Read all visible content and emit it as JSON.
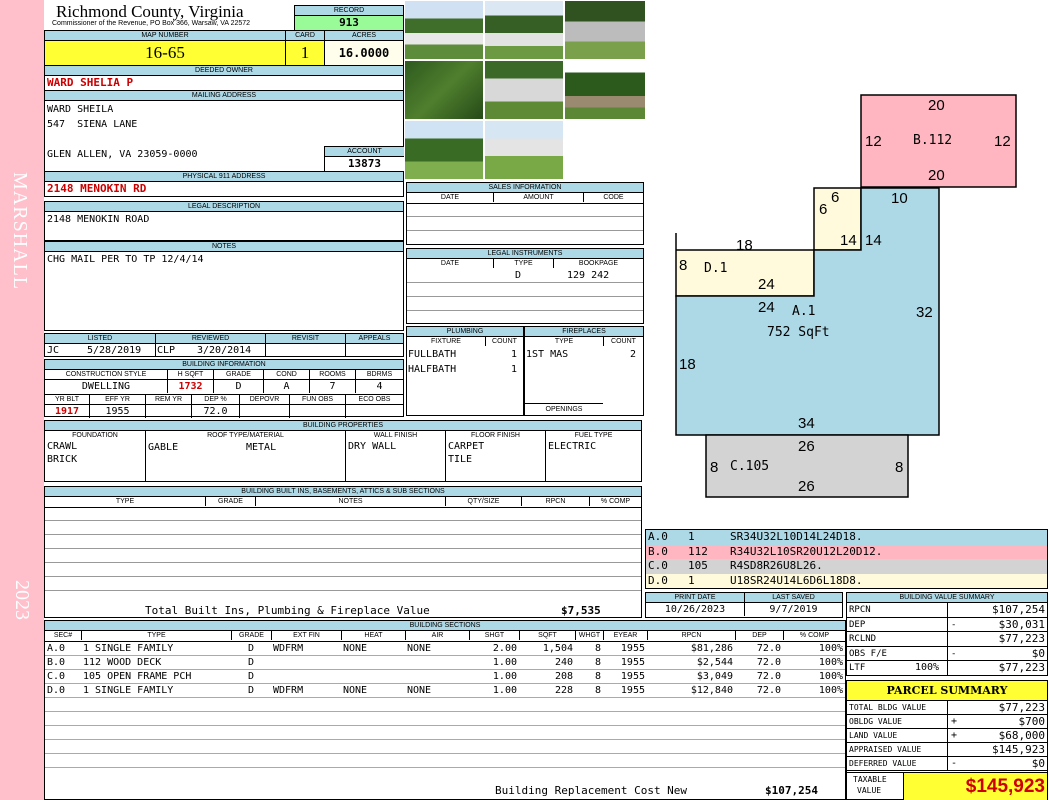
{
  "side": {
    "district": "MARSHALL",
    "year": "2023"
  },
  "county": {
    "name": "Richmond County, Virginia",
    "address": "Commissioner of the Revenue, PO Box 366, Warsaw, VA 22572"
  },
  "record": {
    "label": "RECORD",
    "value": "913"
  },
  "map": {
    "label": "MAP NUMBER",
    "value": "16-65",
    "card_label": "CARD",
    "card": "1",
    "acres_label": "ACRES",
    "acres": "16.0000"
  },
  "owner": {
    "label": "DEEDED OWNER",
    "value": "WARD SHELIA P"
  },
  "mailing": {
    "label": "MAILING ADDRESS",
    "line1": "WARD SHEILA",
    "line2": "547  SIENA LANE",
    "line3": "GLEN ALLEN, VA 23059-0000"
  },
  "account": {
    "label": "ACCOUNT",
    "value": "13873"
  },
  "physical": {
    "label": "PHYSICAL 911 ADDRESS",
    "value": "2148 MENOKIN RD"
  },
  "legal": {
    "label": "LEGAL DESCRIPTION",
    "value": "2148 MENOKIN ROAD"
  },
  "notes": {
    "label": "NOTES",
    "value": "CHG MAIL PER TO TP 12/4/14"
  },
  "review": {
    "listed_label": "LISTED",
    "reviewed_label": "REVIEWED",
    "revisit_label": "REVISIT",
    "appeals_label": "APPEALS",
    "listed_by": "JC",
    "listed_date": "5/28/2019",
    "reviewed_by": "CLP",
    "reviewed_date": "3/20/2014"
  },
  "building_info": {
    "label": "BUILDING INFORMATION",
    "h": [
      "CONSTRUCTION STYLE",
      "H SQFT",
      "GRADE",
      "COND",
      "ROOMS",
      "BDRMS"
    ],
    "v": [
      "DWELLING",
      "1732",
      "D",
      "A",
      "7",
      "4"
    ],
    "h2": [
      "YR BLT",
      "EFF YR",
      "REM YR",
      "DEP %",
      "DEPOVR",
      "FUN OBS",
      "ECO OBS"
    ],
    "v2": [
      "1917",
      "1955",
      "",
      "72.0",
      "",
      "",
      ""
    ]
  },
  "sales": {
    "label": "SALES INFORMATION",
    "h": [
      "DATE",
      "AMOUNT",
      "CODE"
    ]
  },
  "legal_inst": {
    "label": "LEGAL INSTRUMENTS",
    "h": [
      "DATE",
      "TYPE",
      "BOOKPAGE"
    ],
    "type": "D",
    "bookpage": "129 242"
  },
  "plumbing": {
    "label": "PLUMBING",
    "h": [
      "FIXTURE",
      "COUNT"
    ],
    "rows": [
      [
        "FULLBATH",
        "1"
      ],
      [
        "HALFBATH",
        "1"
      ]
    ]
  },
  "fireplaces": {
    "label": "FIREPLACES",
    "h": [
      "TYPE",
      "COUNT"
    ],
    "rows": [
      [
        "1ST MAS",
        "2"
      ]
    ],
    "openings": "OPENINGS"
  },
  "props": {
    "label": "BUILDING PROPERTIES",
    "h": [
      "FOUNDATION",
      "ROOF TYPE/MATERIAL",
      "WALL FINISH",
      "FLOOR FINISH",
      "FUEL TYPE"
    ],
    "foundation1": "CRAWL",
    "foundation2": "BRICK",
    "roof_type": "GABLE",
    "roof_material": "METAL",
    "wall": "DRY WALL",
    "floor1": "CARPET",
    "floor2": "TILE",
    "fuel": "ELECTRIC"
  },
  "builtins": {
    "label": "BUILDING BUILT INS, BASEMENTS, ATTICS & SUB SECTIONS",
    "h": [
      "TYPE",
      "GRADE",
      "NOTES",
      "QTY/SIZE",
      "RPCN",
      "% COMP"
    ],
    "total_label": "Total Built Ins, Plumbing & Fireplace Value",
    "total": "$7,535"
  },
  "sections": {
    "label": "BUILDING SECTIONS",
    "h": [
      "SEC#",
      "TYPE",
      "GRADE",
      "EXT FIN",
      "HEAT",
      "AIR",
      "SHGT",
      "SQFT",
      "WHGT",
      "EYEAR",
      "RPCN",
      "DEP",
      "% COMP"
    ],
    "rows": [
      [
        "A.0",
        "1 SINGLE FAMILY",
        "D",
        "WDFRM",
        "NONE",
        "NONE",
        "2.00",
        "1,504",
        "8",
        "1955",
        "$81,286",
        "72.0",
        "100%"
      ],
      [
        "B.0",
        "112 WOOD DECK",
        "D",
        "",
        "",
        "",
        "1.00",
        "240",
        "8",
        "1955",
        "$2,544",
        "72.0",
        "100%"
      ],
      [
        "C.0",
        "105 OPEN FRAME PCH",
        "D",
        "",
        "",
        "",
        "1.00",
        "208",
        "8",
        "1955",
        "$3,049",
        "72.0",
        "100%"
      ],
      [
        "D.0",
        "1 SINGLE FAMILY",
        "D",
        "WDFRM",
        "NONE",
        "NONE",
        "1.00",
        "228",
        "8",
        "1955",
        "$12,840",
        "72.0",
        "100%"
      ]
    ],
    "replacement_label": "Building Replacement Cost New",
    "replacement": "$107,254"
  },
  "sketch": {
    "b_label": "B.112",
    "d_label": "D.1",
    "a_label": "A.1",
    "a_sqft": "752 SqFt",
    "c_label": "C.105",
    "dims": {
      "b_top": "20",
      "b_left": "12",
      "b_right": "12",
      "b_bottom": "20",
      "s6a": "6",
      "s6b": "6",
      "s10": "10",
      "d18": "18",
      "d14": "14",
      "d14b": "14",
      "d8": "8",
      "d24": "24",
      "a24": "24",
      "a32": "32",
      "a18": "18",
      "a34": "34",
      "c26": "26",
      "c8l": "8",
      "c8r": "8",
      "c26b": "26"
    }
  },
  "vectors": [
    {
      "sec": "A.0",
      "num": "1",
      "path": "SR34U32L10D14L24D18.",
      "color": "#add8e6"
    },
    {
      "sec": "B.0",
      "num": "112",
      "path": "R34U32L10SR20U12L20D12.",
      "color": "#ffb6c1"
    },
    {
      "sec": "C.0",
      "num": "105",
      "path": "R4SD8R26U8L26.",
      "color": "#d3d3d3"
    },
    {
      "sec": "D.0",
      "num": "1",
      "path": "U18SR24U14L6D6L18D8.",
      "color": "#fffadc"
    }
  ],
  "dates": {
    "print_label": "PRINT DATE",
    "print": "10/26/2023",
    "saved_label": "LAST SAVED",
    "saved": "9/7/2019"
  },
  "value_summary": {
    "label": "BUILDING VALUE SUMMARY",
    "rows": [
      {
        "k": "RPCN",
        "s": "",
        "v": "$107,254"
      },
      {
        "k": "DEP",
        "s": "-",
        "v": "$30,031"
      },
      {
        "k": "RCLND",
        "s": "",
        "v": "$77,223"
      },
      {
        "k": "OBS F/E",
        "s": "-",
        "v": "$0"
      },
      {
        "k": "LTF",
        "p": "100%",
        "s": "",
        "v": "$77,223"
      }
    ]
  },
  "parcel": {
    "label": "PARCEL SUMMARY",
    "rows": [
      {
        "k": "TOTAL BLDG VALUE",
        "s": "",
        "v": "$77,223"
      },
      {
        "k": "OBLDG VALUE",
        "s": "+",
        "v": "$700"
      },
      {
        "k": "LAND VALUE",
        "s": "+",
        "v": "$68,000"
      },
      {
        "k": "APPRAISED VALUE",
        "s": "",
        "v": "$145,923"
      },
      {
        "k": "DEFERRED VALUE",
        "s": "-",
        "v": "$0"
      }
    ],
    "taxable_label1": "TAXABLE",
    "taxable_label2": "VALUE",
    "taxable": "$145,923"
  }
}
